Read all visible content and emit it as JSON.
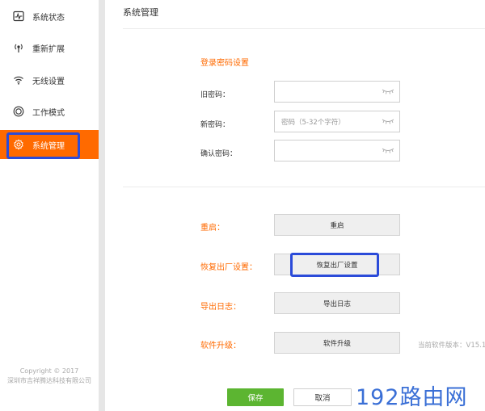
{
  "sidebar": {
    "items": [
      {
        "label": "系统状态",
        "icon": "pulse-monitor-icon"
      },
      {
        "label": "重新扩展",
        "icon": "antenna-signal-icon"
      },
      {
        "label": "无线设置",
        "icon": "wifi-icon"
      },
      {
        "label": "工作模式",
        "icon": "circle-mode-icon"
      },
      {
        "label": "系统管理",
        "icon": "gear-icon",
        "active": true
      }
    ],
    "copyright_line1": "Copyright © 2017",
    "copyright_line2": "深圳市吉祥腾达科技有限公司"
  },
  "main": {
    "page_title": "系统管理",
    "password_section": {
      "title": "登录密码设置",
      "fields": [
        {
          "label": "旧密码：",
          "placeholder": ""
        },
        {
          "label": "新密码：",
          "placeholder": "密码（5-32个字符）"
        },
        {
          "label": "确认密码：",
          "placeholder": ""
        }
      ]
    },
    "actions": [
      {
        "label": "重启：",
        "button": "重启"
      },
      {
        "label": "恢复出厂设置：",
        "button": "恢复出厂设置"
      },
      {
        "label": "导出日志：",
        "button": "导出日志"
      },
      {
        "label": "软件升级：",
        "button": "软件升级"
      }
    ],
    "firmware_version_text": "当前软件版本：V15.1"
  },
  "footer": {
    "save_label": "保存",
    "cancel_label": "取消"
  },
  "watermark": "192路由网",
  "colors": {
    "accent": "#ff6a00",
    "save_green": "#5cb531",
    "highlight_blue": "#2b4bd9",
    "watermark_blue": "#3a6fd6"
  }
}
